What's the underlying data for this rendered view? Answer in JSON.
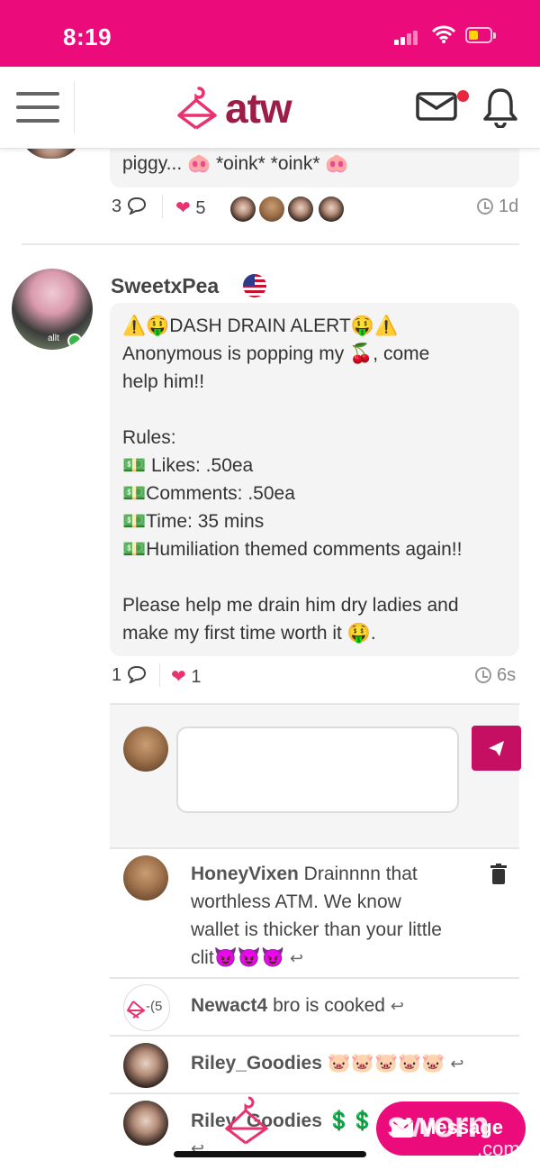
{
  "status_bar": {
    "time": "8:19"
  },
  "navbar": {
    "logo_text": "atw"
  },
  "prev_post": {
    "text": "piggy... 🐽 *oink* *oink* 🐽",
    "comment_count": "3",
    "like_count": "5",
    "time_ago": "1d"
  },
  "post": {
    "username": "SweetxPea",
    "avatar_watermark": "allt",
    "body": [
      "⚠️🤑DASH DRAIN ALERT🤑⚠️",
      "Anonymous is popping my 🍒, come",
      "help him!!",
      "",
      "Rules:",
      "💵 Likes: .50ea",
      "💵Comments: .50ea",
      "💵Time: 35 mins",
      "💵Humiliation themed comments again!!",
      "",
      "Please help me drain him dry ladies and",
      "make my first time worth it 🤑."
    ],
    "comment_count": "1",
    "like_count": "1",
    "time_ago": "6s"
  },
  "compose": {
    "placeholder": ""
  },
  "comments": [
    {
      "user": "HoneyVixen",
      "lines": [
        "Drainnnn that",
        "worthless ATM. We know",
        "wallet is thicker than your little",
        "clit😈😈😈"
      ]
    },
    {
      "user": "Newact4",
      "lines": [
        "bro is cooked"
      ],
      "avatar_text": "-(5"
    },
    {
      "user": "Riley_Goodies",
      "lines": [
        "🐷🐷🐷🐷🐷"
      ]
    },
    {
      "user": "Riley_Goodies",
      "lines": [
        "💲💲"
      ]
    }
  ],
  "fab": {
    "label": "Message"
  },
  "watermark": {
    "big": "sworn",
    "small": ".com"
  },
  "colors": {
    "brand_pink": "#ec0b7a",
    "logo_maroon": "#9e1c48",
    "send_button": "#c40f62",
    "heart": "#e8336f"
  }
}
